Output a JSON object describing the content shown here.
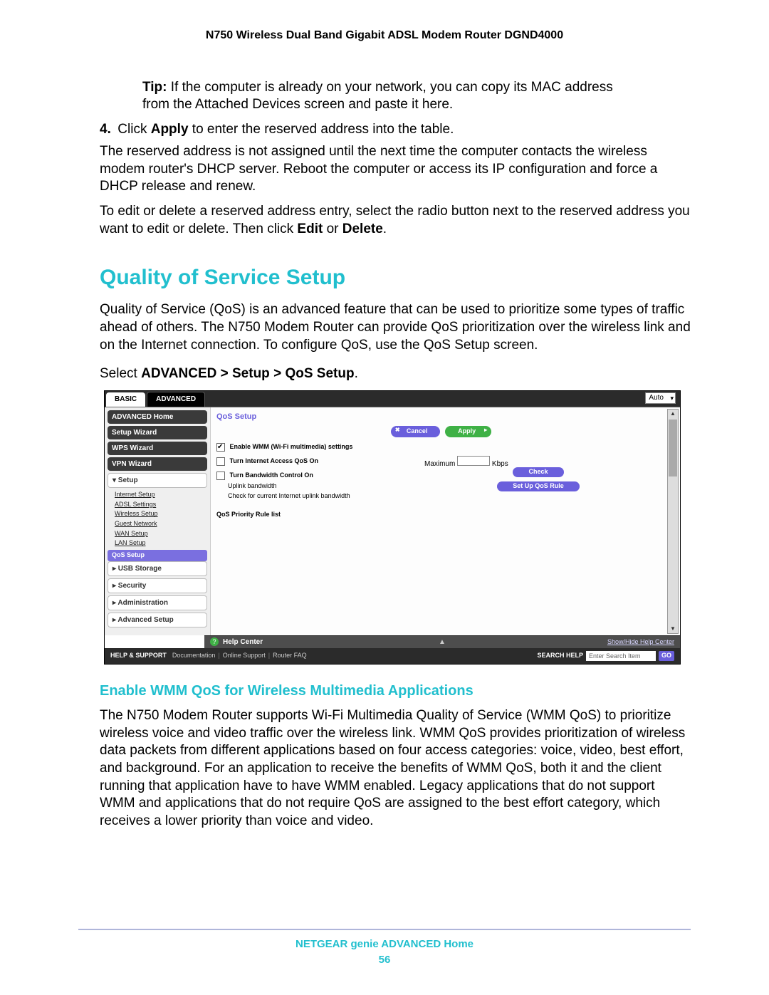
{
  "doc_header": "N750 Wireless Dual Band Gigabit ADSL Modem Router DGND4000",
  "tip_label": "Tip:",
  "tip_text": "If the computer is already on your network, you can copy its MAC address from the Attached Devices screen and paste it here.",
  "step4_num": "4.",
  "step4_line": "Click Apply to enter the reserved address into the table.",
  "step4_click": "Click ",
  "step4_apply": "Apply",
  "step4_rest": " to enter the reserved address into the table.",
  "step4_para": "The reserved address is not assigned until the next time the computer contacts the wireless modem router's DHCP server. Reboot the computer or access its IP configuration and force a DHCP release and renew.",
  "edit_para_a": "To edit or delete a reserved address entry, select the radio button next to the reserved address you want to edit or delete. Then click ",
  "edit_bold": "Edit",
  "edit_or": " or ",
  "delete_bold": "Delete",
  "edit_end": ".",
  "h1": "Quality of Service Setup",
  "qos_para": "Quality of Service (QoS) is an advanced feature that can be used to prioritize some types of traffic ahead of others. The N750 Modem Router can provide QoS prioritization over the wireless link and on the Internet connection. To configure QoS, use the QoS Setup screen.",
  "select_line_a": "Select ",
  "select_line_b": "ADVANCED > Setup > QoS Setup",
  "select_line_c": ".",
  "ui": {
    "tab_basic": "BASIC",
    "tab_advanced": "ADVANCED",
    "auto": "Auto",
    "sidebar": {
      "adv_home": "ADVANCED Home",
      "setup_wizard": "Setup Wizard",
      "wps_wizard": "WPS Wizard",
      "vpn_wizard": "VPN Wizard",
      "setup": "▾ Setup",
      "subs": {
        "internet": "Internet Setup",
        "adsl": "ADSL Settings",
        "wireless": "Wireless Setup",
        "guest": "Guest Network",
        "wan": "WAN Setup",
        "lan": "LAN Setup",
        "qos": "QoS Setup"
      },
      "usb": "▸ USB Storage",
      "security": "▸ Security",
      "admin": "▸ Administration",
      "adv_setup": "▸ Advanced Setup"
    },
    "title": "QoS Setup",
    "btn_cancel": "Cancel",
    "btn_apply": "Apply",
    "chk_wmm": "Enable WMM (Wi-Fi multimedia) settings",
    "chk_inet": "Turn Internet Access QoS On",
    "chk_bw": "Turn Bandwidth Control On",
    "uplink": "Uplink bandwidth",
    "maximum": "Maximum",
    "kbps": "Kbps",
    "check_uplink": "Check for current Internet uplink bandwidth",
    "btn_check": "Check",
    "rule_list": "QoS Priority Rule list",
    "btn_setup_rule": "Set Up QoS Rule",
    "help_center": "Help Center",
    "show_hide": "Show/Hide Help Center",
    "help_support": "HELP & SUPPORT",
    "doc": "Documentation",
    "online": "Online Support",
    "faq": "Router FAQ",
    "search_help": "SEARCH HELP",
    "search_placeholder": "Enter Search Item",
    "go": "GO"
  },
  "h2": "Enable WMM QoS for Wireless Multimedia Applications",
  "wmm_para": "The N750 Modem Router supports Wi-Fi Multimedia Quality of Service (WMM QoS) to prioritize wireless voice and video traffic over the wireless link. WMM QoS provides prioritization of wireless data packets from different applications based on four access categories: voice, video, best effort, and background. For an application to receive the benefits of WMM QoS, both it and the client running that application have to have WMM enabled. Legacy applications that do not support WMM and applications that do not require QoS are assigned to the best effort category, which receives a lower priority than voice and video.",
  "footer_title": "NETGEAR genie ADVANCED Home",
  "footer_page": "56"
}
